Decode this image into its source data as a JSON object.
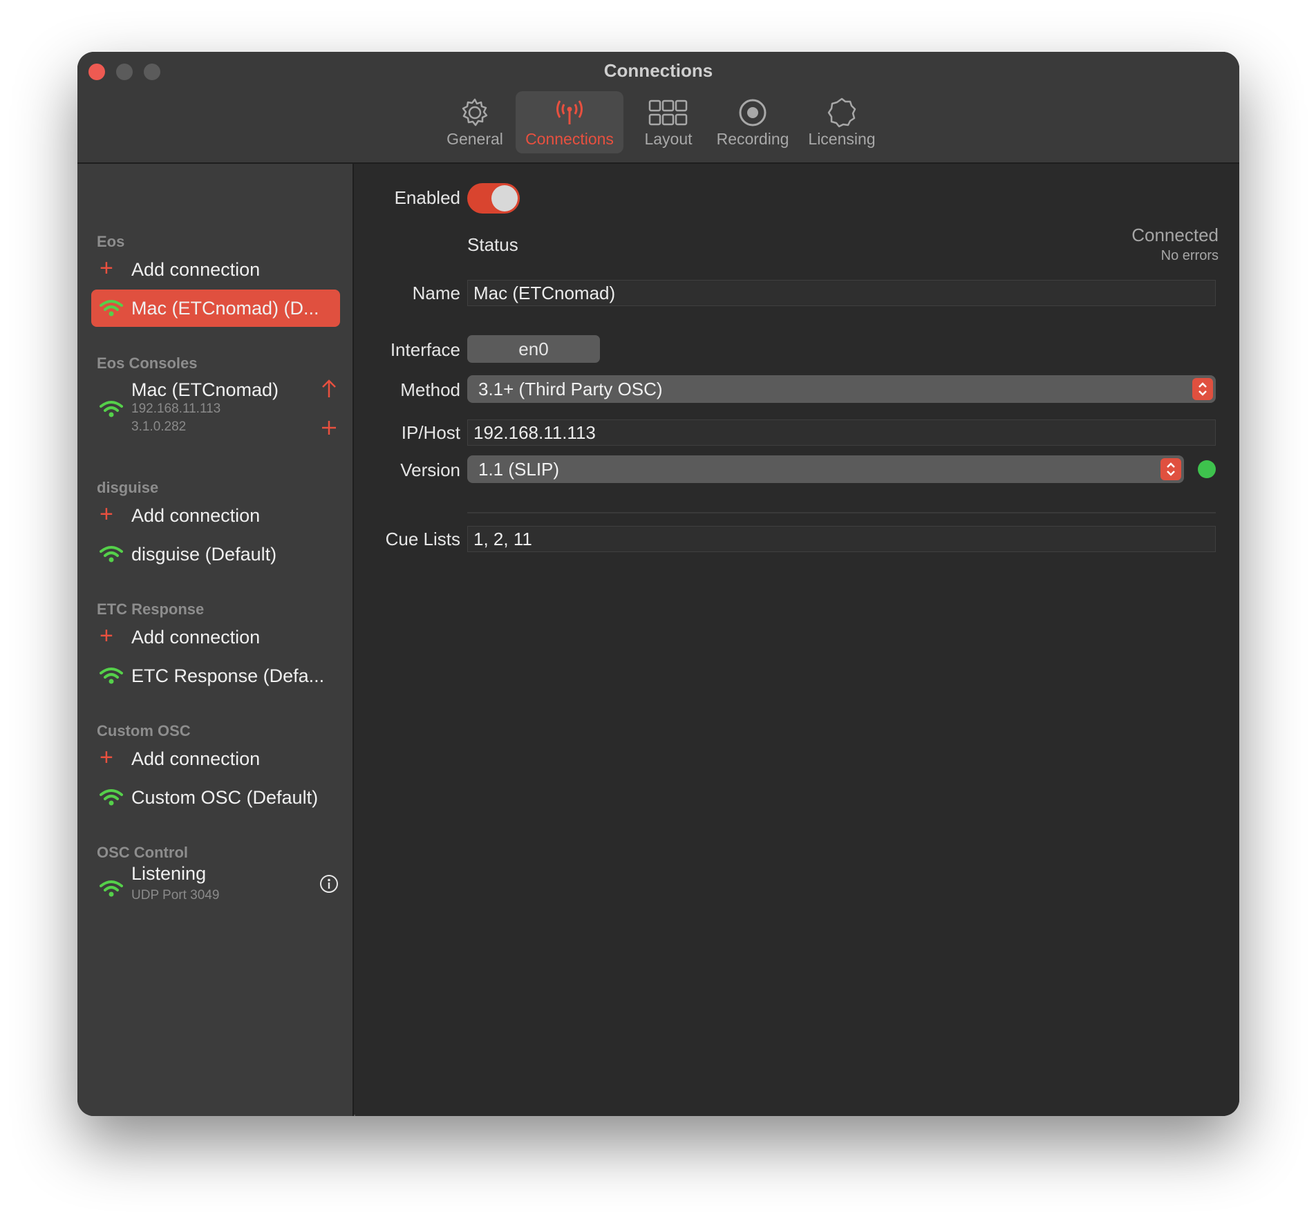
{
  "window": {
    "title": "Connections"
  },
  "toolbar": {
    "tabs": [
      {
        "label": "General",
        "icon": "gear-icon"
      },
      {
        "label": "Connections",
        "icon": "antenna-icon"
      },
      {
        "label": "Layout",
        "icon": "grid-icon"
      },
      {
        "label": "Recording",
        "icon": "record-icon"
      },
      {
        "label": "Licensing",
        "icon": "badge-icon"
      }
    ],
    "active": "Connections"
  },
  "sidebar": {
    "eos": {
      "title": "Eos",
      "add_label": "Add connection",
      "selected_item": "Mac (ETCnomad) (D..."
    },
    "eos_consoles": {
      "title": "Eos Consoles",
      "item_name": "Mac (ETCnomad)",
      "item_ip": "192.168.11.113",
      "item_version": "3.1.0.282"
    },
    "disguise": {
      "title": "disguise",
      "add_label": "Add connection",
      "item": "disguise (Default)"
    },
    "etc_response": {
      "title": "ETC Response",
      "add_label": "Add connection",
      "item": "ETC Response (Defa..."
    },
    "custom_osc": {
      "title": "Custom OSC",
      "add_label": "Add connection",
      "item": "Custom OSC (Default)"
    },
    "osc_control": {
      "title": "OSC Control",
      "item": "Listening",
      "item_sub": "UDP Port 3049"
    }
  },
  "detail": {
    "enabled_label": "Enabled",
    "enabled": true,
    "status_label": "Status",
    "status_value": "Connected",
    "status_sub": "No errors",
    "name_label": "Name",
    "name_value": "Mac (ETCnomad)",
    "interface_label": "Interface",
    "interface_value": "en0",
    "method_label": "Method",
    "method_value": "3.1+ (Third Party OSC)",
    "iphost_label": "IP/Host",
    "iphost_value": "192.168.11.113",
    "version_label": "Version",
    "version_value": "1.1 (SLIP)",
    "cuelists_label": "Cue Lists",
    "cuelists_value": "1, 2, 11"
  },
  "colors": {
    "accent": "#e0503f",
    "wifi_green": "#55d04a",
    "status_green": "#3ec24d"
  }
}
